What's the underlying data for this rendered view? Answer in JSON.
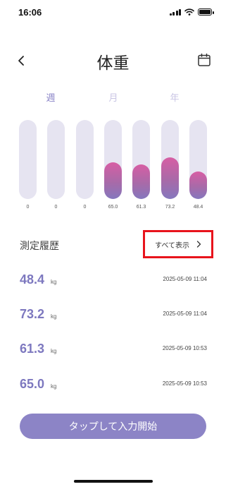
{
  "status_bar": {
    "time": "16:06"
  },
  "header": {
    "title": "体重"
  },
  "period_tabs": [
    {
      "label": "週",
      "active": true
    },
    {
      "label": "月",
      "active": false
    },
    {
      "label": "年",
      "active": false
    }
  ],
  "chart_data": {
    "type": "bar",
    "categories": [
      "",
      "",
      "",
      "",
      "",
      "",
      ""
    ],
    "values": [
      0,
      0,
      0,
      65.0,
      61.3,
      73.2,
      48.4
    ],
    "value_labels": [
      "0",
      "0",
      "0",
      "65.0",
      "61.3",
      "73.2",
      "48.4"
    ],
    "ylim": [
      0,
      140
    ],
    "colors": {
      "track": "#e6e4f1",
      "fill_top": "#d75ea4",
      "fill_bottom": "#8577bd"
    }
  },
  "history": {
    "title": "測定履歴",
    "show_all_label": "すべて表示",
    "records": [
      {
        "value": "48.4",
        "unit": "kg",
        "timestamp": "2025-05-09 11:04"
      },
      {
        "value": "73.2",
        "unit": "kg",
        "timestamp": "2025-05-09 11:04"
      },
      {
        "value": "61.3",
        "unit": "kg",
        "timestamp": "2025-05-09 10:53"
      },
      {
        "value": "65.0",
        "unit": "kg",
        "timestamp": "2025-05-09 10:53"
      }
    ]
  },
  "start_button_label": "タップして入力開始",
  "icons": {
    "back": "chevron-left-icon",
    "calendar": "calendar-icon",
    "show_all": "chevron-right-icon"
  },
  "colors": {
    "accent": "#8c84c6",
    "value_text": "#7d78bf",
    "highlight_border": "#e8141c"
  }
}
